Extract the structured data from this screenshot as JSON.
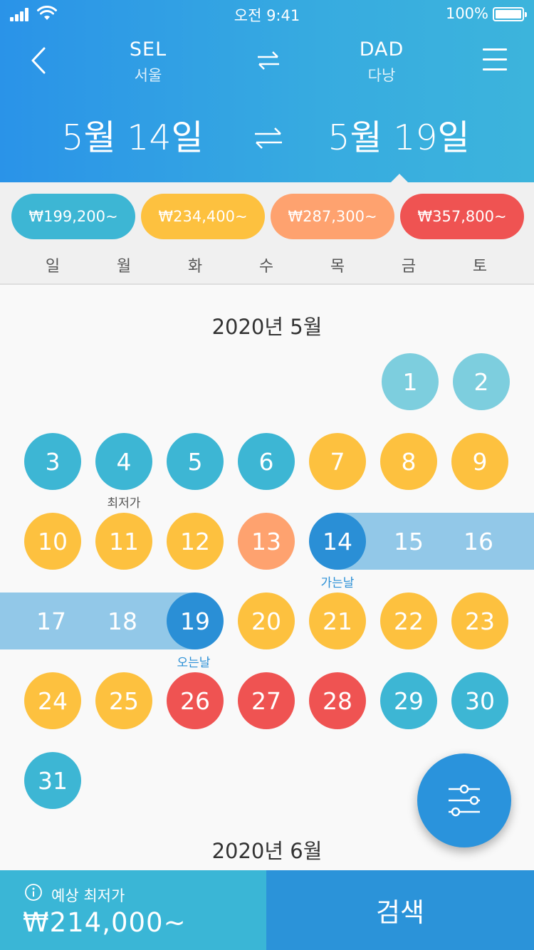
{
  "status_bar": {
    "time": "오전 9:41",
    "battery": "100%"
  },
  "route": {
    "origin_code": "SEL",
    "origin_city": "서울",
    "dest_code": "DAD",
    "dest_city": "다낭"
  },
  "dates": {
    "depart": "5월 14일",
    "return": "5월 19일"
  },
  "price_chips": [
    {
      "label": "₩199,200~",
      "color": "#3db6d4"
    },
    {
      "label": "₩234,400~",
      "color": "#fdc13f"
    },
    {
      "label": "₩287,300~",
      "color": "#fea26f"
    },
    {
      "label": "₩357,800~",
      "color": "#ef5352"
    }
  ],
  "weekdays": [
    "일",
    "월",
    "화",
    "수",
    "목",
    "금",
    "토"
  ],
  "months": [
    {
      "title": "2020년 5월",
      "days": [
        {
          "label": "1",
          "color": "#7dcede"
        },
        {
          "label": "2",
          "color": "#7dcede"
        },
        {
          "label": "3",
          "color": "#3db6d4"
        },
        {
          "label": "4",
          "color": "#3db6d4",
          "note": "최저가"
        },
        {
          "label": "5",
          "color": "#3db6d4"
        },
        {
          "label": "6",
          "color": "#3db6d4"
        },
        {
          "label": "7",
          "color": "#fdc13f"
        },
        {
          "label": "8",
          "color": "#fdc13f"
        },
        {
          "label": "9",
          "color": "#fdc13f"
        },
        {
          "label": "10",
          "color": "#fdc13f"
        },
        {
          "label": "11",
          "color": "#fdc13f"
        },
        {
          "label": "12",
          "color": "#fdc13f"
        },
        {
          "label": "13",
          "color": "#fea26f"
        },
        {
          "label": "14",
          "color": "#2a8fd6",
          "note": "가는날"
        },
        {
          "label": "15",
          "color": ""
        },
        {
          "label": "16",
          "color": ""
        },
        {
          "label": "17",
          "color": ""
        },
        {
          "label": "18",
          "color": ""
        },
        {
          "label": "19",
          "color": "#2a8fd6",
          "note": "오는날"
        },
        {
          "label": "20",
          "color": "#fdc13f"
        },
        {
          "label": "21",
          "color": "#fdc13f"
        },
        {
          "label": "22",
          "color": "#fdc13f"
        },
        {
          "label": "23",
          "color": "#fdc13f"
        },
        {
          "label": "24",
          "color": "#fdc13f"
        },
        {
          "label": "25",
          "color": "#fdc13f"
        },
        {
          "label": "26",
          "color": "#ef5352"
        },
        {
          "label": "27",
          "color": "#ef5352"
        },
        {
          "label": "28",
          "color": "#ef5352"
        },
        {
          "label": "29",
          "color": "#3db6d4"
        },
        {
          "label": "30",
          "color": "#3db6d4"
        },
        {
          "label": "31",
          "color": "#3db6d4"
        }
      ]
    },
    {
      "title": "2020년 6월"
    }
  ],
  "range_color": "#92c8e8",
  "bottom": {
    "estimate_label": "예상 최저가",
    "estimate_price": "₩214,000~",
    "search_label": "검색"
  },
  "icons": [
    "signal-icon",
    "wifi-icon",
    "battery-icon",
    "back-arrow-icon",
    "swap-icon",
    "menu-icon",
    "filter-icon",
    "info-icon"
  ]
}
